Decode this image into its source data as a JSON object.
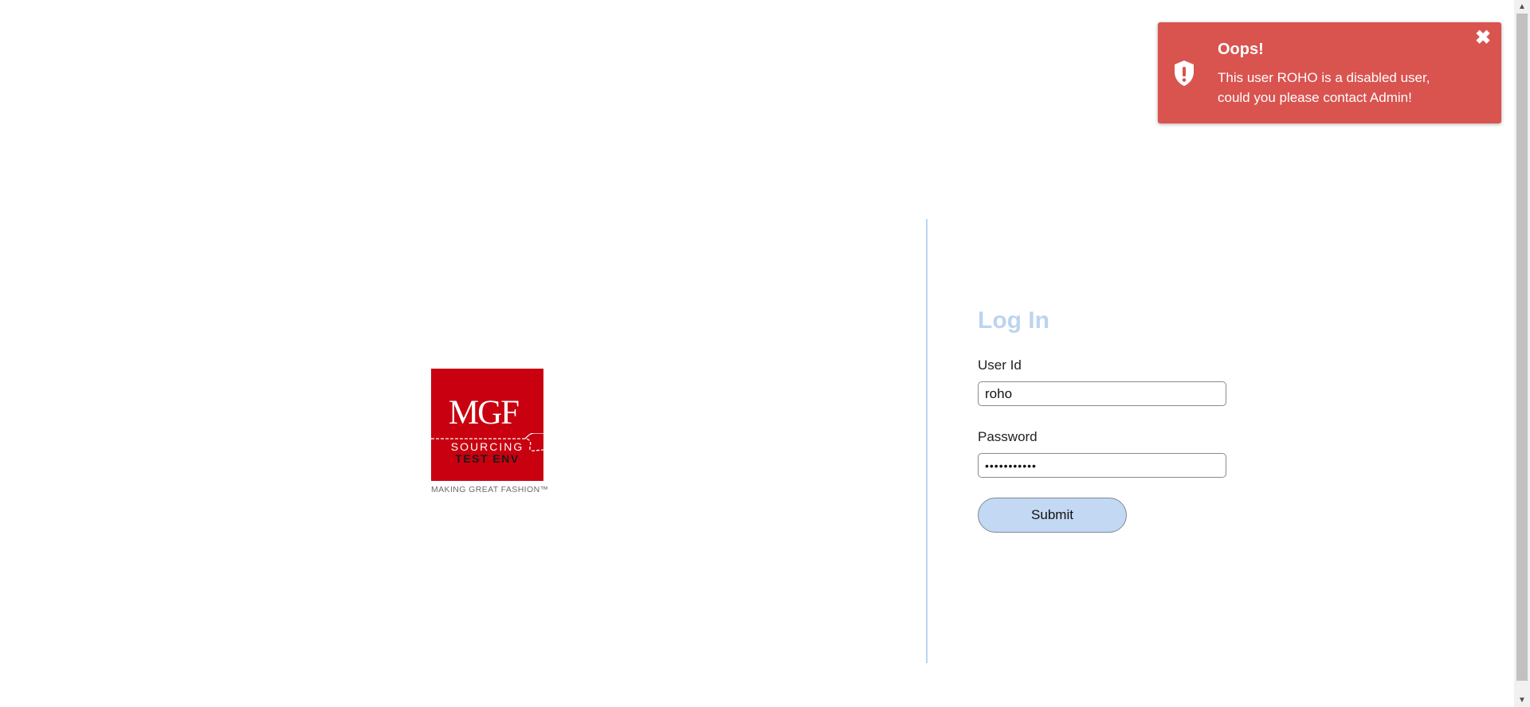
{
  "logo": {
    "brand": "MGF",
    "line1": "SOURCING",
    "line2": "TEST ENV",
    "tagline": "MAKING GREAT FASHION™",
    "brand_color": "#c8000f"
  },
  "login": {
    "title": "Log In",
    "user_id_label": "User Id",
    "user_id_value": "roho",
    "password_label": "Password",
    "password_value": "•••••••••••",
    "submit_label": "Submit",
    "accent_color": "#bcd4ef"
  },
  "toast": {
    "icon": "shield-exclamation-icon",
    "title": "Oops!",
    "message": "This user ROHO is a disabled user, could you please contact Admin!",
    "close_icon": "close-icon",
    "close_glyph": "✖",
    "color": "#d9534f"
  },
  "scrollbar": {
    "up_glyph": "▲",
    "down_glyph": "▼"
  }
}
